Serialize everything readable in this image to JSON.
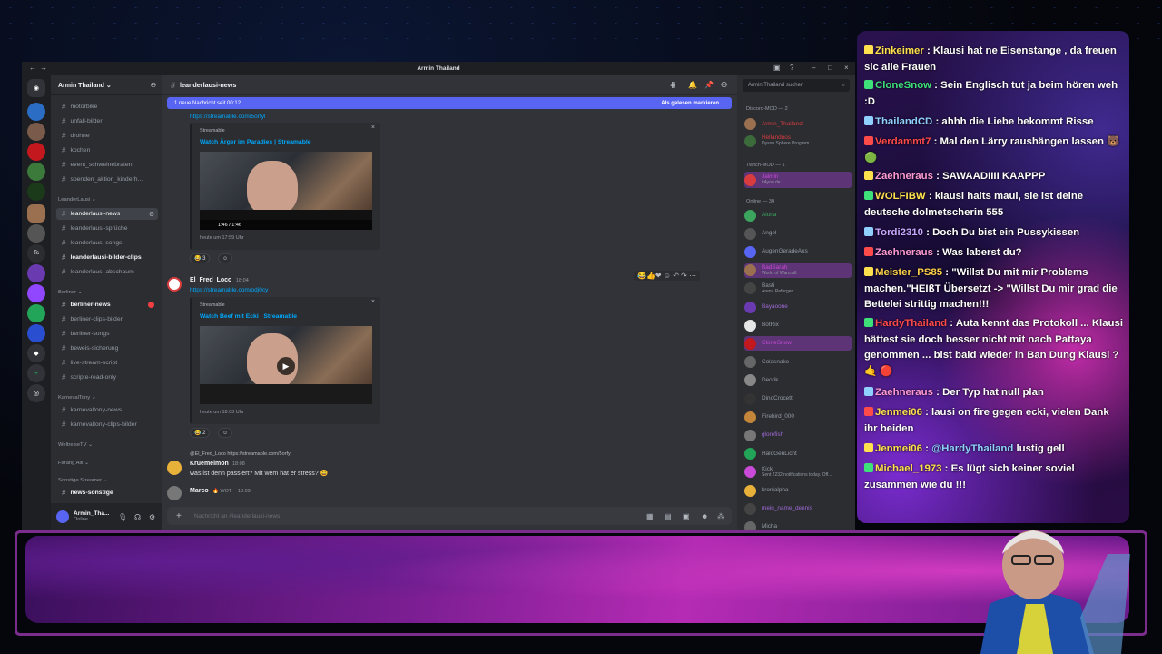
{
  "window": {
    "title": "Armin Thailand"
  },
  "server": {
    "name": "Armin Thailand ⌄"
  },
  "channels": [
    {
      "label": "motorbike",
      "y": 0
    },
    {
      "label": "unfall-bilder"
    },
    {
      "label": "drohne"
    },
    {
      "label": "kochen"
    },
    {
      "label": "event_schweinebraten"
    },
    {
      "label": "spenden_aktion_kinderh..."
    }
  ],
  "categories": {
    "leanderlausi": "LeanderLausi ⌄",
    "berliner": "Berliner ⌄",
    "karneval": "KarnevalTony ⌄",
    "weltreise": "WeltreiseTV ⌄",
    "farang": "Farang Alli ⌄",
    "sonstige": "Sonstige Streamer ⌄"
  },
  "channels_leander": [
    "leanderlausi-news",
    "leanderlausi-sprüche",
    "leanderlausi-songs",
    "leanderlausi-bilder-clips",
    "leanderlausi-abschaum"
  ],
  "channels_berliner": [
    "berliner-news",
    "berliner-clips-bilder",
    "berliner-songs",
    "beweis-sicherung",
    "live-stream-script",
    "scripte-read-only"
  ],
  "channels_karneval": [
    "karnevaltony-news",
    "karnevaltony-clips-bilder"
  ],
  "channels_sonstige": [
    "news-sonstige"
  ],
  "user_panel": {
    "name": "Armin_Tha...",
    "status": "Online"
  },
  "chat": {
    "channel": "leanderlausi-news",
    "new_bar": "1 neue Nachricht seit 00:12",
    "mark_read": "Als gelesen markieren",
    "msg1_link": "https://streamable.com/5orfyl",
    "embed1_provider": "Streamable",
    "embed1_title": "Watch Ärger im Paradies | Streamable",
    "embed1_time": "1:46 / 1:46",
    "embed1_date": "heute um 17:59 Uhr",
    "react1": "😂 3",
    "msg2_author": "El_Fred_Loco",
    "msg2_time": "18:04",
    "msg2_link": "https://streamable.com/odj0cy",
    "embed2_provider": "Streamable",
    "embed2_title": "Watch Beef mit Ecki | Streamable",
    "embed2_date": "heute um 18:03 Uhr",
    "react2": "😂 2",
    "reply_ref": "@El_Fred_Loco https://streamable.com/5orfyl",
    "msg3_author": "Kruemelmon",
    "msg3_time": "18:08",
    "msg3_text": "was ist denn passiert? Mit wem hat er stress? 😄",
    "msg4_author": "Marco",
    "msg4_badge": "🔥 WOT",
    "msg4_time": "18:09",
    "input_placeholder": "Nachricht an #leanderlausi-news"
  },
  "members": {
    "search": "Armin Thailand suchen",
    "sections": {
      "mod": "Discord-MOD — 2",
      "twitch": "Twitch-MOD — 1",
      "online": "Online — 30"
    },
    "list": [
      {
        "name": "Armin_Thailand",
        "color": "#d83c3e"
      },
      {
        "name": "Hellandnos",
        "color": "#d83c3e",
        "sub": "Dyson Sphere Program"
      },
      {
        "name": "Jaimin",
        "color": "#c94ad6",
        "sub": "ir4you.de"
      },
      {
        "name": "Aluna",
        "color": "#3ba55d"
      },
      {
        "name": "Angel",
        "color": "#949ba4"
      },
      {
        "name": "AugenGeradeAus",
        "color": "#949ba4"
      },
      {
        "name": "BadSarah",
        "color": "#c94ad6",
        "sub": "World of Warcraft"
      },
      {
        "name": "Basti",
        "color": "#949ba4",
        "sub": "Arena Refurger"
      },
      {
        "name": "Bayaoone",
        "color": "#a06ad6"
      },
      {
        "name": "BotRix",
        "color": "#949ba4"
      },
      {
        "name": "CloneSnow",
        "color": "#c94ad6"
      },
      {
        "name": "Colasnake",
        "color": "#949ba4"
      },
      {
        "name": "Deorik",
        "color": "#949ba4"
      },
      {
        "name": "DinoCrocetti",
        "color": "#949ba4"
      },
      {
        "name": "Firebird_000",
        "color": "#949ba4"
      },
      {
        "name": "glorefish",
        "color": "#a06ad6"
      },
      {
        "name": "HaloGenLicht",
        "color": "#949ba4"
      },
      {
        "name": "Kick",
        "color": "#949ba4",
        "sub": "Sent 2232 notifications today. Off..."
      },
      {
        "name": "kronialpha",
        "color": "#949ba4"
      },
      {
        "name": "mein_name_dennis",
        "color": "#a06ad6"
      },
      {
        "name": "Micha",
        "color": "#949ba4"
      }
    ]
  },
  "twitch_chat": [
    {
      "user": "Zinkeimer",
      "color": "#ffe14d",
      "text": " : Klausi hat ne Eisenstange , da freuen sic alle Frauen"
    },
    {
      "user": "CloneSnow",
      "color": "#3ee07a",
      "text": " : Sein Englisch tut ja beim hören weh :D"
    },
    {
      "user": "ThailandCD",
      "color": "#8fd0ff",
      "text": " : ahhh die Liebe bekommt Risse"
    },
    {
      "user": "Verdammt7",
      "color": "#ff4a4a",
      "text": " : Mal den Lärry raushängen lassen 🐻 🟢"
    },
    {
      "user": "Zaehneraus",
      "color": "#ff9ad5",
      "text": " : SAWAADIIII KAAPPP"
    },
    {
      "user": "WOLFIBW",
      "color": "#ffe14d",
      "text": " : klausi halts maul, sie ist deine deutsche dolmetscherin 555"
    },
    {
      "user": "Tordi2310",
      "color": "#c7a7ff",
      "text": " : Doch Du bist ein Pussykissen"
    },
    {
      "user": "Zaehneraus",
      "color": "#ff9ad5",
      "text": " : Was laberst du?"
    },
    {
      "user": "Meister_PS85",
      "color": "#ffd24a",
      "text": " : \"Willst Du mit mir Problems machen.\"HEIßT Übersetzt -> \"Willst Du mir grad die Bettelei strittig machen!!!"
    },
    {
      "user": "HardyThailand",
      "color": "#ff4a4a",
      "text": " : Auta kennt das Protokoll ... Klausi hättest sie doch besser nicht mit nach Pattaya genommen ... bist bald wieder in Ban Dung Klausi ? 🤙 🔴"
    },
    {
      "user": "Zaehneraus",
      "color": "#ff9ad5",
      "text": " : Der Typ hat null plan"
    },
    {
      "user": "Jenmei06",
      "color": "#ffe14d",
      "text": " : lausi on fire gegen ecki, vielen Dank ihr beiden"
    },
    {
      "user": "Jenmei06",
      "color": "#ffe14d",
      "text": " : ",
      "mention": "@HardyThailand",
      "after": " lustig gell"
    },
    {
      "user": "Michael_1973",
      "color": "#ffe14d",
      "text": " : Es lügt sich keiner soviel zusammen wie du !!!"
    }
  ]
}
